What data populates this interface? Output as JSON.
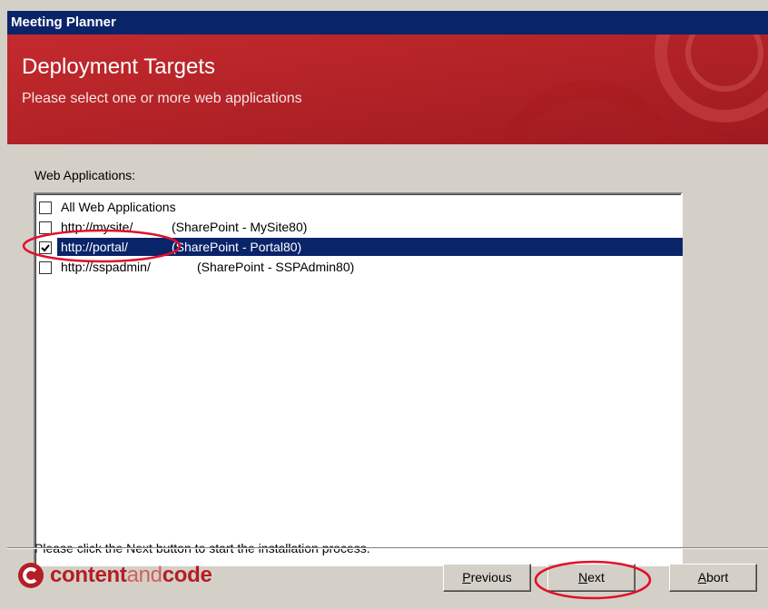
{
  "window": {
    "title": "Meeting Planner"
  },
  "header": {
    "title": "Deployment Targets",
    "subtitle": "Please select one or more web applications"
  },
  "web_apps": {
    "label": "Web Applications:",
    "items": [
      {
        "url": "All Web Applications",
        "app": "",
        "checked": false,
        "selected": false
      },
      {
        "url": "http://mysite/",
        "app": "(SharePoint - MySite80)",
        "checked": false,
        "selected": false
      },
      {
        "url": "http://portal/",
        "app": "(SharePoint - Portal80)",
        "checked": true,
        "selected": true
      },
      {
        "url": "http://sspadmin/",
        "app": "(SharePoint - SSPAdmin80)",
        "checked": false,
        "selected": false
      }
    ]
  },
  "instruction": "Please click the Next button to start the installation process.",
  "logo": {
    "part1": "content",
    "part2": "and",
    "part3": "code"
  },
  "buttons": {
    "previous": {
      "first": "P",
      "rest": "revious"
    },
    "next": {
      "first": "N",
      "rest": "ext"
    },
    "abort": {
      "first": "A",
      "rest": "bort"
    }
  },
  "colors": {
    "titlebar": "#0a246a",
    "banner": "#b41e24",
    "selection": "#0a246a",
    "annotation": "#e0102a"
  }
}
